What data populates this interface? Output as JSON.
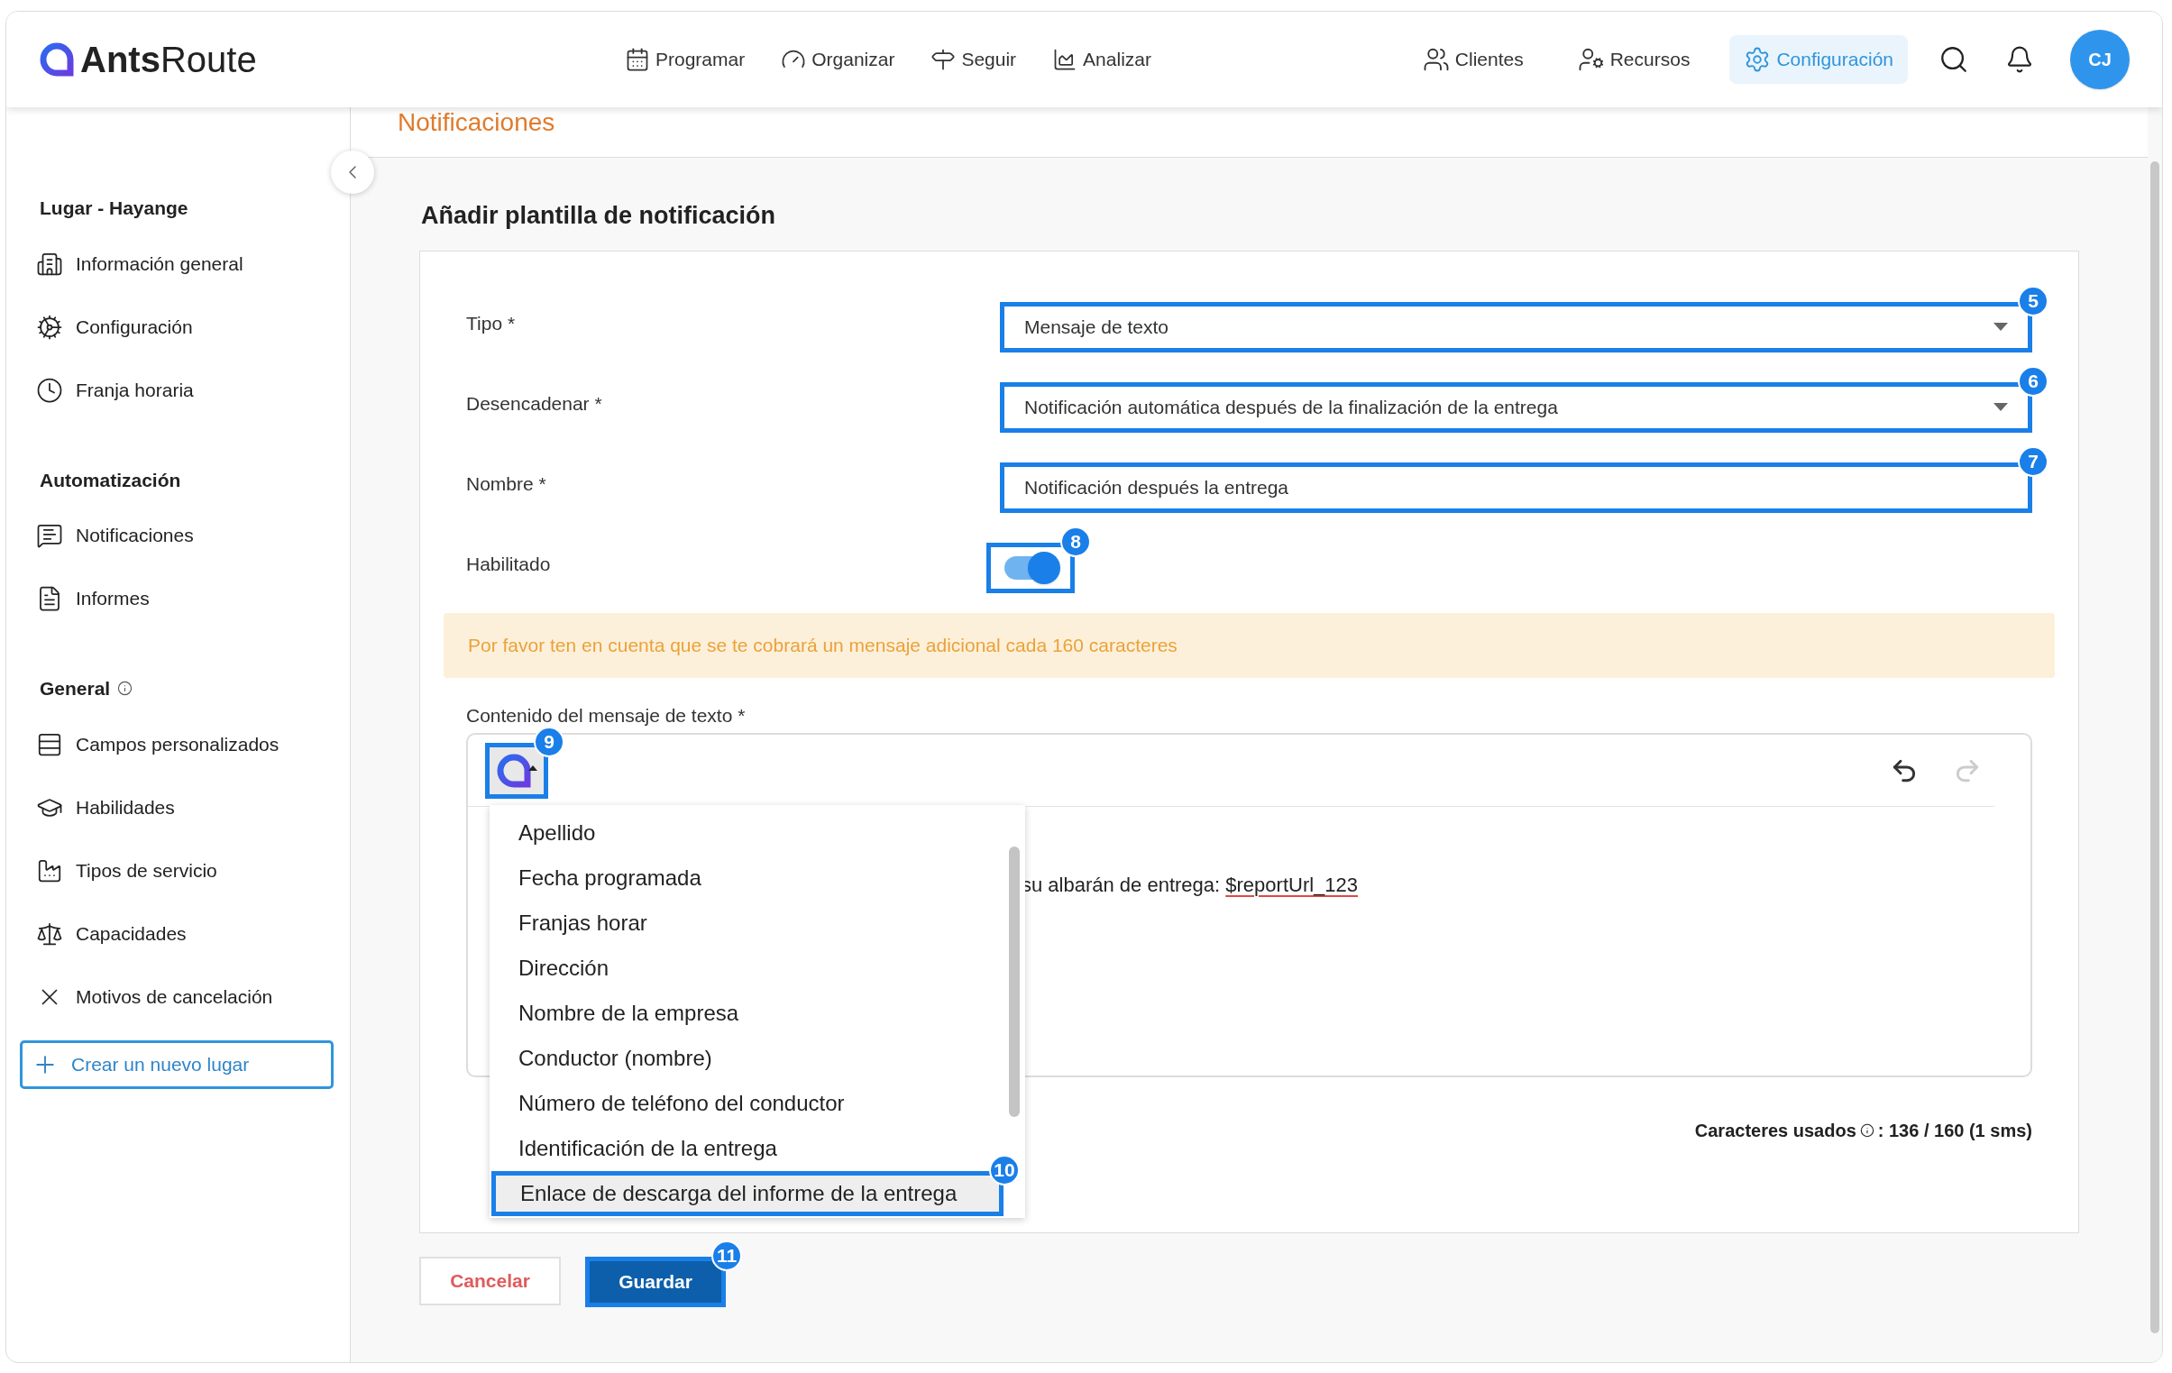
{
  "header": {
    "logo": {
      "bold": "Ants",
      "light": "Route"
    },
    "nav": [
      {
        "label": "Programar"
      },
      {
        "label": "Organizar"
      },
      {
        "label": "Seguir"
      },
      {
        "label": "Analizar"
      }
    ],
    "right_nav": [
      {
        "label": "Clientes",
        "selected": false
      },
      {
        "label": "Recursos",
        "selected": false
      },
      {
        "label": "Configuración",
        "selected": true
      }
    ],
    "avatar": "CJ"
  },
  "page_title": "Notificaciones",
  "sidebar": {
    "sections": [
      {
        "title": "Lugar - Hayange",
        "info": false,
        "items": [
          {
            "label": "Información general"
          },
          {
            "label": "Configuración"
          },
          {
            "label": "Franja horaria"
          }
        ]
      },
      {
        "title": "Automatización",
        "info": false,
        "items": [
          {
            "label": "Notificaciones"
          },
          {
            "label": "Informes"
          }
        ]
      },
      {
        "title": "General",
        "info": true,
        "items": [
          {
            "label": "Campos personalizados"
          },
          {
            "label": "Habilidades"
          },
          {
            "label": "Tipos de servicio"
          },
          {
            "label": "Capacidades"
          },
          {
            "label": "Motivos de cancelación"
          }
        ]
      }
    ],
    "new_place_button": "Crear un nuevo lugar"
  },
  "form": {
    "title": "Añadir plantilla de notificación",
    "fields": [
      {
        "kind": "select",
        "label": "Tipo *",
        "value": "Mensaje de texto",
        "badge": "5"
      },
      {
        "kind": "select",
        "label": "Desencadenar *",
        "value": "Notificación automática después de la finalización de la entrega",
        "badge": "6"
      },
      {
        "kind": "text",
        "label": "Nombre *",
        "value": "Notificación después la entrega",
        "badge": "7"
      },
      {
        "kind": "toggle",
        "label": "Habilitado",
        "on": true,
        "badge": "8"
      }
    ],
    "notice": "Por favor ten en cuenta que se te cobrará un mensaje adicional cada 160 caracteres",
    "editor": {
      "label": "Contenido del mensaje de texto *",
      "insert_badge": "9",
      "text": "su albarán de entrega: ",
      "variable": "$reportUrl_123"
    },
    "dropdown": {
      "items": [
        {
          "label": "Apellido",
          "selected": false
        },
        {
          "label": "Fecha programada",
          "selected": false
        },
        {
          "label": "Franjas horar",
          "selected": false
        },
        {
          "label": "Dirección",
          "selected": false
        },
        {
          "label": "Nombre de la empresa",
          "selected": false
        },
        {
          "label": "Conductor (nombre)",
          "selected": false
        },
        {
          "label": "Número de teléfono del conductor",
          "selected": false
        },
        {
          "label": "Identificación de la entrega",
          "selected": false
        },
        {
          "label": "Enlace de descarga del informe de la entrega",
          "selected": true,
          "badge": "10"
        }
      ]
    },
    "counter": {
      "label": "Caracteres usados",
      "value": ": 136 / 160 (1 sms)"
    },
    "buttons": [
      {
        "kind": "cancel",
        "label": "Cancelar"
      },
      {
        "kind": "save",
        "label": "Guardar",
        "badge": "11"
      }
    ]
  }
}
